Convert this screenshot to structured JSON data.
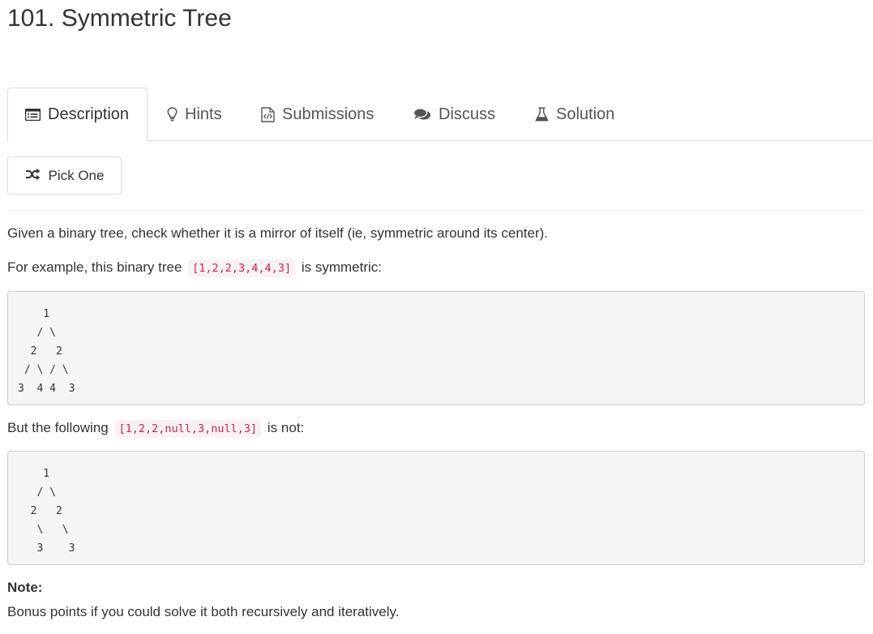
{
  "problem": {
    "title": "101. Symmetric Tree"
  },
  "tabs": [
    {
      "label": "Description",
      "icon": "list-alt-icon",
      "active": true
    },
    {
      "label": "Hints",
      "icon": "lightbulb-icon",
      "active": false
    },
    {
      "label": "Submissions",
      "icon": "file-code-icon",
      "active": false
    },
    {
      "label": "Discuss",
      "icon": "comments-icon",
      "active": false
    },
    {
      "label": "Solution",
      "icon": "flask-icon",
      "active": false
    }
  ],
  "toolbar": {
    "pick_one_label": "Pick One",
    "pick_one_icon": "random-icon"
  },
  "description": {
    "intro": "Given a binary tree, check whether it is a mirror of itself (ie, symmetric around its center).",
    "example1_prefix": "For example, this binary tree",
    "example1_code": "[1,2,2,3,4,4,3]",
    "example1_suffix": "is symmetric:",
    "tree1": "    1\n   / \\\n  2   2\n / \\ / \\\n3  4 4  3",
    "example2_prefix": "But the following",
    "example2_code": "[1,2,2,null,3,null,3]",
    "example2_suffix": "is not:",
    "tree2": "    1\n   / \\\n  2   2\n   \\   \\\n   3    3",
    "note_label": "Note:",
    "note_text": "Bonus points if you could solve it both recursively and iteratively."
  },
  "colors": {
    "inline_code": "#c7254e",
    "inline_code_bg": "#f9f2f4",
    "pre_bg": "#f5f5f5",
    "border": "#dddddd"
  }
}
